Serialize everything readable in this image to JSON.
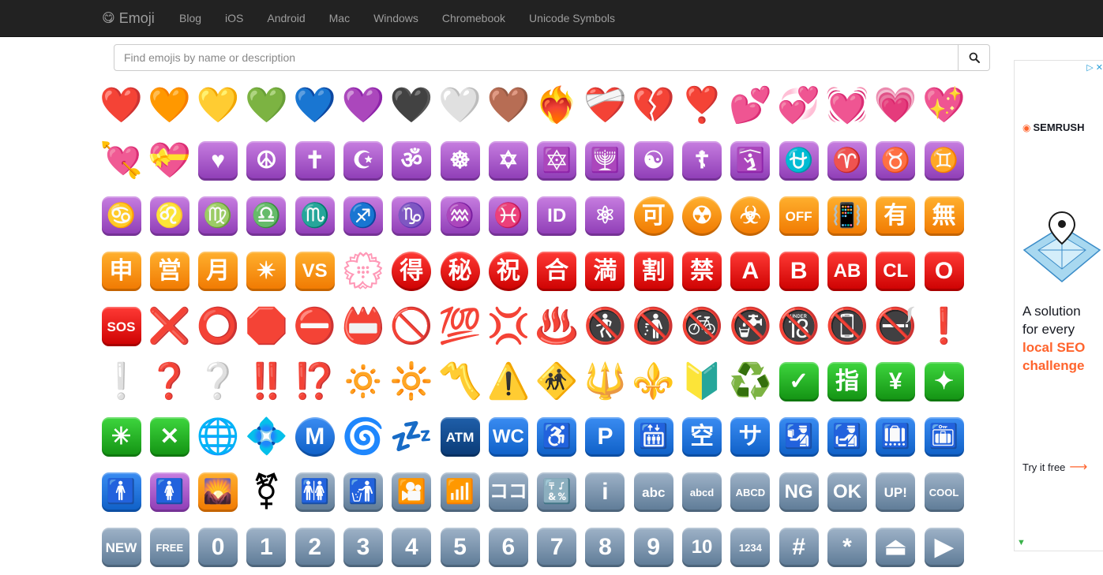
{
  "nav": {
    "brand": "Emoji",
    "links": [
      "Blog",
      "iOS",
      "Android",
      "Mac",
      "Windows",
      "Chromebook",
      "Unicode Symbols"
    ]
  },
  "search": {
    "placeholder": "Find emojis by name or description"
  },
  "emojis": [
    {
      "g": "❤️",
      "n": "red-heart"
    },
    {
      "g": "🧡",
      "n": "orange-heart"
    },
    {
      "g": "💛",
      "n": "yellow-heart"
    },
    {
      "g": "💚",
      "n": "green-heart"
    },
    {
      "g": "💙",
      "n": "blue-heart"
    },
    {
      "g": "💜",
      "n": "purple-heart"
    },
    {
      "g": "🖤",
      "n": "black-heart"
    },
    {
      "g": "🤍",
      "n": "white-heart"
    },
    {
      "g": "🤎",
      "n": "brown-heart"
    },
    {
      "g": "❤️‍🔥",
      "n": "heart-on-fire"
    },
    {
      "g": "❤️‍🩹",
      "n": "mending-heart"
    },
    {
      "g": "💔",
      "n": "broken-heart"
    },
    {
      "g": "❣️",
      "n": "heart-exclamation"
    },
    {
      "g": "💕",
      "n": "two-hearts"
    },
    {
      "g": "💞",
      "n": "revolving-hearts"
    },
    {
      "g": "💓",
      "n": "beating-heart"
    },
    {
      "g": "💗",
      "n": "growing-heart"
    },
    {
      "g": "💖",
      "n": "sparkling-heart"
    },
    {
      "g": "💘",
      "n": "heart-with-arrow"
    },
    {
      "g": "💝",
      "n": "heart-with-ribbon"
    },
    {
      "t": "♥",
      "c": "purple",
      "n": "heart-suit"
    },
    {
      "t": "☮",
      "c": "purple",
      "n": "peace-symbol"
    },
    {
      "t": "✝",
      "c": "purple",
      "n": "latin-cross"
    },
    {
      "t": "☪",
      "c": "purple",
      "n": "star-and-crescent"
    },
    {
      "t": "ॐ",
      "c": "purple",
      "n": "om"
    },
    {
      "t": "☸",
      "c": "purple",
      "n": "wheel-of-dharma"
    },
    {
      "t": "✡",
      "c": "purple",
      "n": "star-of-david"
    },
    {
      "t": "🔯",
      "c": "purple",
      "n": "dotted-six-pointed-star"
    },
    {
      "t": "🕎",
      "c": "purple",
      "n": "menorah"
    },
    {
      "t": "☯",
      "c": "purple",
      "n": "yin-yang"
    },
    {
      "t": "☦",
      "c": "purple",
      "n": "orthodox-cross"
    },
    {
      "t": "🛐",
      "c": "purple",
      "n": "place-of-worship"
    },
    {
      "t": "⛎",
      "c": "purple",
      "n": "ophiuchus"
    },
    {
      "t": "♈",
      "c": "purple",
      "n": "aries"
    },
    {
      "t": "♉",
      "c": "purple",
      "n": "taurus"
    },
    {
      "t": "♊",
      "c": "purple",
      "n": "gemini"
    },
    {
      "t": "♋",
      "c": "purple",
      "n": "cancer"
    },
    {
      "t": "♌",
      "c": "purple",
      "n": "leo"
    },
    {
      "t": "♍",
      "c": "purple",
      "n": "virgo"
    },
    {
      "t": "♎",
      "c": "purple",
      "n": "libra"
    },
    {
      "t": "♏",
      "c": "purple",
      "n": "scorpio"
    },
    {
      "t": "♐",
      "c": "purple",
      "n": "sagittarius"
    },
    {
      "t": "♑",
      "c": "purple",
      "n": "capricorn"
    },
    {
      "t": "♒",
      "c": "purple",
      "n": "aquarius"
    },
    {
      "t": "♓",
      "c": "purple",
      "n": "pisces"
    },
    {
      "t": "ID",
      "c": "purple",
      "n": "id-button"
    },
    {
      "t": "⚛",
      "c": "purple",
      "n": "atom-symbol"
    },
    {
      "t": "可",
      "c": "orange",
      "s": "circle",
      "n": "accept-button"
    },
    {
      "t": "☢",
      "c": "orange",
      "s": "circle",
      "n": "radioactive"
    },
    {
      "t": "☣",
      "c": "orange",
      "s": "circle",
      "n": "biohazard"
    },
    {
      "t": "OFF",
      "c": "orange",
      "n": "mobile-phone-off"
    },
    {
      "t": "📳",
      "c": "orange",
      "n": "vibration-mode"
    },
    {
      "t": "有",
      "c": "orange",
      "n": "not-free-of-charge"
    },
    {
      "t": "無",
      "c": "orange",
      "n": "free-of-charge"
    },
    {
      "t": "申",
      "c": "orange",
      "n": "application-button"
    },
    {
      "t": "営",
      "c": "orange",
      "n": "open-for-business"
    },
    {
      "t": "月",
      "c": "orange",
      "n": "monthly-amount"
    },
    {
      "t": "✴",
      "c": "orange",
      "n": "eight-pointed-star"
    },
    {
      "t": "VS",
      "c": "orange",
      "n": "vs-button"
    },
    {
      "g": "💮",
      "n": "white-flower"
    },
    {
      "t": "得",
      "c": "red",
      "s": "circle",
      "n": "bargain-button"
    },
    {
      "t": "秘",
      "c": "red",
      "s": "circle",
      "n": "secret-button"
    },
    {
      "t": "祝",
      "c": "red",
      "s": "circle",
      "n": "congratulations-button"
    },
    {
      "t": "合",
      "c": "red",
      "n": "passing-grade"
    },
    {
      "t": "満",
      "c": "red",
      "n": "no-vacancy"
    },
    {
      "t": "割",
      "c": "red",
      "n": "discount-button"
    },
    {
      "t": "禁",
      "c": "red",
      "n": "prohibited-button"
    },
    {
      "t": "A",
      "c": "red",
      "n": "a-button"
    },
    {
      "t": "B",
      "c": "red",
      "n": "b-button"
    },
    {
      "t": "AB",
      "c": "red",
      "n": "ab-button"
    },
    {
      "t": "CL",
      "c": "red",
      "n": "cl-button"
    },
    {
      "t": "O",
      "c": "red",
      "n": "o-button"
    },
    {
      "t": "SOS",
      "c": "red",
      "n": "sos-button"
    },
    {
      "g": "❌",
      "n": "cross-mark"
    },
    {
      "g": "⭕",
      "n": "hollow-red-circle"
    },
    {
      "g": "🛑",
      "n": "stop-sign"
    },
    {
      "g": "⛔",
      "n": "no-entry"
    },
    {
      "g": "📛",
      "n": "name-badge"
    },
    {
      "g": "🚫",
      "n": "prohibited"
    },
    {
      "g": "💯",
      "n": "hundred-points"
    },
    {
      "g": "💢",
      "n": "anger-symbol"
    },
    {
      "g": "♨️",
      "n": "hot-springs"
    },
    {
      "g": "🚷",
      "n": "no-pedestrians"
    },
    {
      "g": "🚯",
      "n": "no-littering"
    },
    {
      "g": "🚳",
      "n": "no-bicycles"
    },
    {
      "g": "🚱",
      "n": "non-potable-water"
    },
    {
      "g": "🔞",
      "n": "no-one-under-eighteen"
    },
    {
      "g": "📵",
      "n": "no-mobile-phones"
    },
    {
      "g": "🚭",
      "n": "no-smoking"
    },
    {
      "g": "❗",
      "n": "red-exclamation"
    },
    {
      "g": "❕",
      "n": "white-exclamation"
    },
    {
      "g": "❓",
      "n": "red-question"
    },
    {
      "g": "❔",
      "n": "white-question"
    },
    {
      "g": "‼️",
      "n": "double-exclamation"
    },
    {
      "g": "⁉️",
      "n": "exclamation-question"
    },
    {
      "g": "🔅",
      "n": "dim-button"
    },
    {
      "g": "🔆",
      "n": "bright-button"
    },
    {
      "g": "〽️",
      "n": "part-alternation-mark"
    },
    {
      "g": "⚠️",
      "n": "warning"
    },
    {
      "g": "🚸",
      "n": "children-crossing"
    },
    {
      "g": "🔱",
      "n": "trident-emblem"
    },
    {
      "g": "⚜️",
      "n": "fleur-de-lis"
    },
    {
      "g": "🔰",
      "n": "japanese-beginner"
    },
    {
      "g": "♻️",
      "n": "recycling-symbol"
    },
    {
      "t": "✓",
      "c": "green",
      "n": "check-mark-button"
    },
    {
      "t": "指",
      "c": "green",
      "n": "reserved-button"
    },
    {
      "t": "¥",
      "c": "green",
      "n": "chart-increasing-yen"
    },
    {
      "t": "✦",
      "c": "green",
      "n": "sparkle"
    },
    {
      "t": "✳",
      "c": "green",
      "n": "eight-spoked-asterisk"
    },
    {
      "t": "✕",
      "c": "green",
      "n": "cross-mark-button"
    },
    {
      "g": "🌐",
      "n": "globe-with-meridians"
    },
    {
      "g": "💠",
      "n": "diamond-with-a-dot"
    },
    {
      "t": "M",
      "c": "blue",
      "s": "circle",
      "n": "circled-m"
    },
    {
      "g": "🌀",
      "n": "cyclone"
    },
    {
      "g": "💤",
      "n": "zzz"
    },
    {
      "t": "ATM",
      "c": "dkblue",
      "n": "atm-sign"
    },
    {
      "t": "WC",
      "c": "blue",
      "n": "water-closet"
    },
    {
      "t": "♿",
      "c": "blue",
      "n": "wheelchair-symbol"
    },
    {
      "t": "P",
      "c": "blue",
      "n": "p-button"
    },
    {
      "t": "🛗",
      "c": "blue",
      "n": "elevator"
    },
    {
      "t": "空",
      "c": "blue",
      "n": "vacancy-button"
    },
    {
      "t": "サ",
      "c": "blue",
      "n": "service-charge"
    },
    {
      "t": "🛂",
      "c": "blue",
      "n": "passport-control"
    },
    {
      "t": "🛃",
      "c": "blue",
      "n": "customs"
    },
    {
      "t": "🛄",
      "c": "blue",
      "n": "baggage-claim"
    },
    {
      "t": "🛅",
      "c": "blue",
      "n": "left-luggage"
    },
    {
      "t": "🚹",
      "c": "blue",
      "n": "mens-room"
    },
    {
      "t": "🚺",
      "c": "purple",
      "n": "womens-room"
    },
    {
      "t": "🌄",
      "c": "orange",
      "n": "sunrise-over-mountains"
    },
    {
      "g": "⚧",
      "n": "transgender-symbol"
    },
    {
      "t": "🚻",
      "c": "grey",
      "n": "restroom"
    },
    {
      "t": "🚮",
      "c": "grey",
      "n": "litter-in-bin"
    },
    {
      "t": "🎦",
      "c": "grey",
      "n": "cinema"
    },
    {
      "t": "📶",
      "c": "grey",
      "n": "antenna-bars"
    },
    {
      "t": "ココ",
      "c": "grey",
      "n": "here-button"
    },
    {
      "t": "🔣",
      "c": "grey",
      "n": "input-symbols"
    },
    {
      "t": "i",
      "c": "grey",
      "n": "information"
    },
    {
      "t": "abc",
      "c": "grey",
      "n": "input-latin-letters"
    },
    {
      "t": "abcd",
      "c": "grey",
      "n": "input-latin-lowercase"
    },
    {
      "t": "ABCD",
      "c": "grey",
      "n": "input-latin-uppercase"
    },
    {
      "t": "NG",
      "c": "grey",
      "n": "ng-button"
    },
    {
      "t": "OK",
      "c": "grey",
      "n": "ok-button"
    },
    {
      "t": "UP!",
      "c": "grey",
      "n": "up-button"
    },
    {
      "t": "COOL",
      "c": "grey",
      "n": "cool-button"
    },
    {
      "t": "NEW",
      "c": "grey",
      "n": "new-button"
    },
    {
      "t": "FREE",
      "c": "grey",
      "n": "free-button"
    },
    {
      "t": "0",
      "c": "grey",
      "n": "keycap-0"
    },
    {
      "t": "1",
      "c": "grey",
      "n": "keycap-1"
    },
    {
      "t": "2",
      "c": "grey",
      "n": "keycap-2"
    },
    {
      "t": "3",
      "c": "grey",
      "n": "keycap-3"
    },
    {
      "t": "4",
      "c": "grey",
      "n": "keycap-4"
    },
    {
      "t": "5",
      "c": "grey",
      "n": "keycap-5"
    },
    {
      "t": "6",
      "c": "grey",
      "n": "keycap-6"
    },
    {
      "t": "7",
      "c": "grey",
      "n": "keycap-7"
    },
    {
      "t": "8",
      "c": "grey",
      "n": "keycap-8"
    },
    {
      "t": "9",
      "c": "grey",
      "n": "keycap-9"
    },
    {
      "t": "10",
      "c": "grey",
      "n": "keycap-10"
    },
    {
      "t": "1234",
      "c": "grey",
      "n": "input-numbers"
    },
    {
      "t": "#",
      "c": "grey",
      "n": "keycap-hash"
    },
    {
      "t": "*",
      "c": "grey",
      "n": "keycap-asterisk"
    },
    {
      "t": "⏏",
      "c": "grey",
      "n": "eject-button"
    },
    {
      "t": "▶",
      "c": "grey",
      "n": "play-button"
    }
  ],
  "ad": {
    "brand": "SEMRUSH",
    "line1": "A solution",
    "line2": "for every",
    "highlight1": "local SEO",
    "highlight2": "challenge",
    "cta": "Try it free"
  }
}
